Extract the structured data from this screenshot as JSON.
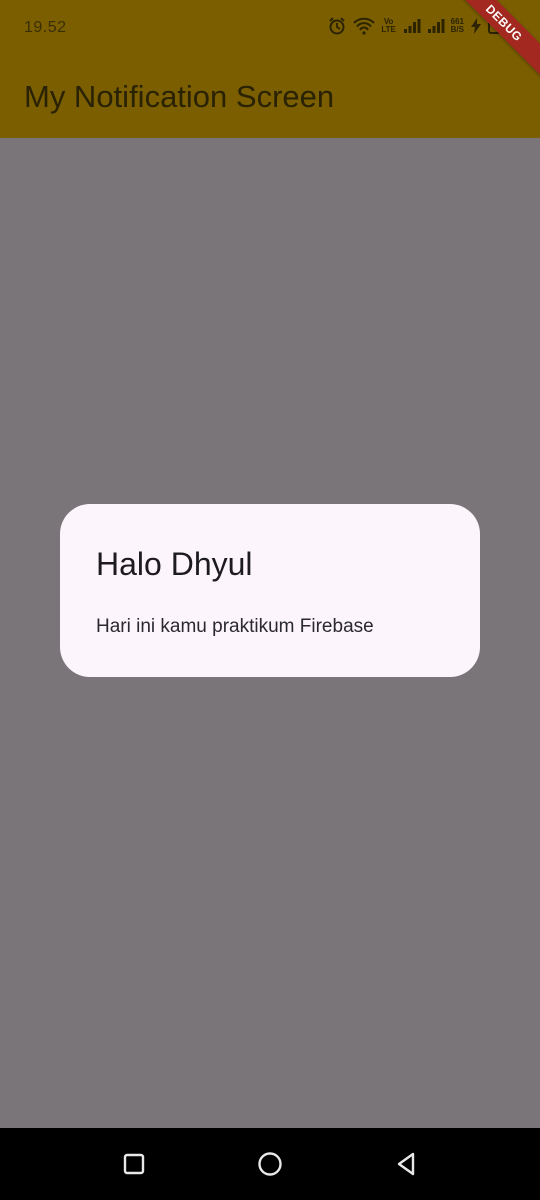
{
  "status_bar": {
    "time": "19.52",
    "volte": "Vo LTE",
    "speed_value": "661",
    "speed_unit": "B/S",
    "battery": "51"
  },
  "app_bar": {
    "title": "My Notification Screen"
  },
  "debug_banner": {
    "label": "DEBUG"
  },
  "dialog": {
    "title": "Halo Dhyul",
    "body": "Hari ini kamu praktikum Firebase"
  },
  "nav_bar": {
    "buttons": [
      "recents",
      "home",
      "back"
    ]
  }
}
